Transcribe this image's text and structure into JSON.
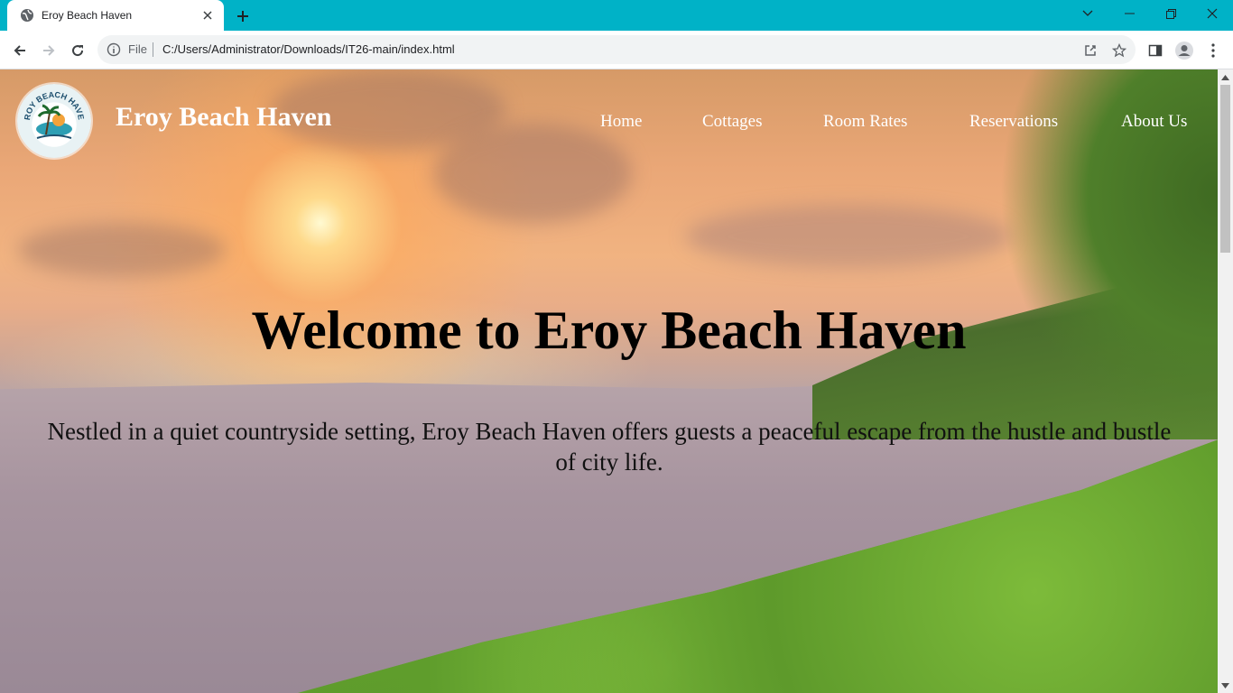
{
  "browser": {
    "tab_title": "Eroy Beach Haven",
    "address_scheme": "File",
    "address_url": "C:/Users/Administrator/Downloads/IT26-main/index.html",
    "accent_color": "#00b2c7"
  },
  "site": {
    "brand": "Eroy Beach Haven",
    "logo_text": "EROY BEACH HAVEN",
    "nav": [
      {
        "label": "Home"
      },
      {
        "label": "Cottages"
      },
      {
        "label": "Room Rates"
      },
      {
        "label": "Reservations"
      },
      {
        "label": "About Us"
      }
    ],
    "hero_title": "Welcome to Eroy Beach Haven",
    "hero_text": "Nestled in a quiet countryside setting, Eroy Beach Haven offers guests a peaceful escape from the hustle and bustle of city life."
  }
}
